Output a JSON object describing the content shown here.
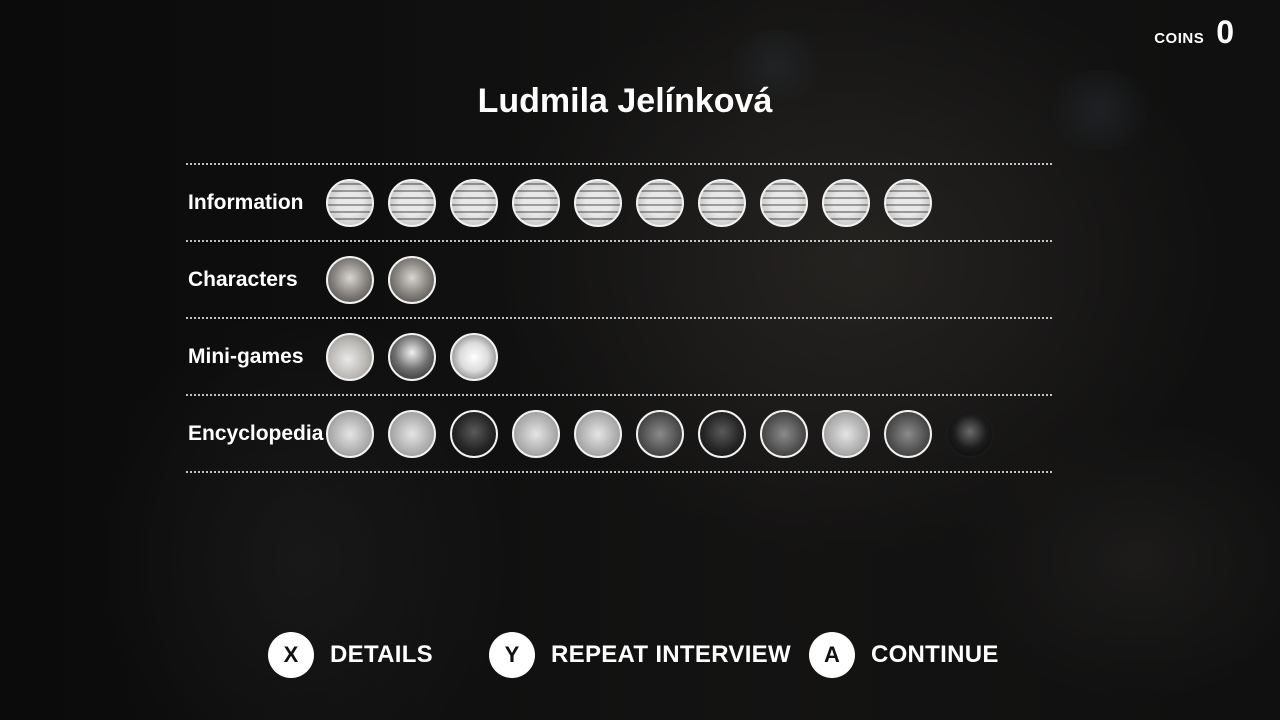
{
  "hud": {
    "coins_label": "COINS",
    "coins_value": "0"
  },
  "title": "Ludmila Jelínková",
  "rows": [
    {
      "label": "Information",
      "count": 10
    },
    {
      "label": "Characters",
      "count": 2
    },
    {
      "label": "Mini-games",
      "count": 3
    },
    {
      "label": "Encyclopedia",
      "count": 11
    }
  ],
  "actions": [
    {
      "key": "X",
      "label": "DETAILS"
    },
    {
      "key": "Y",
      "label": "REPEAT INTERVIEW"
    },
    {
      "key": "A",
      "label": "CONTINUE"
    }
  ]
}
